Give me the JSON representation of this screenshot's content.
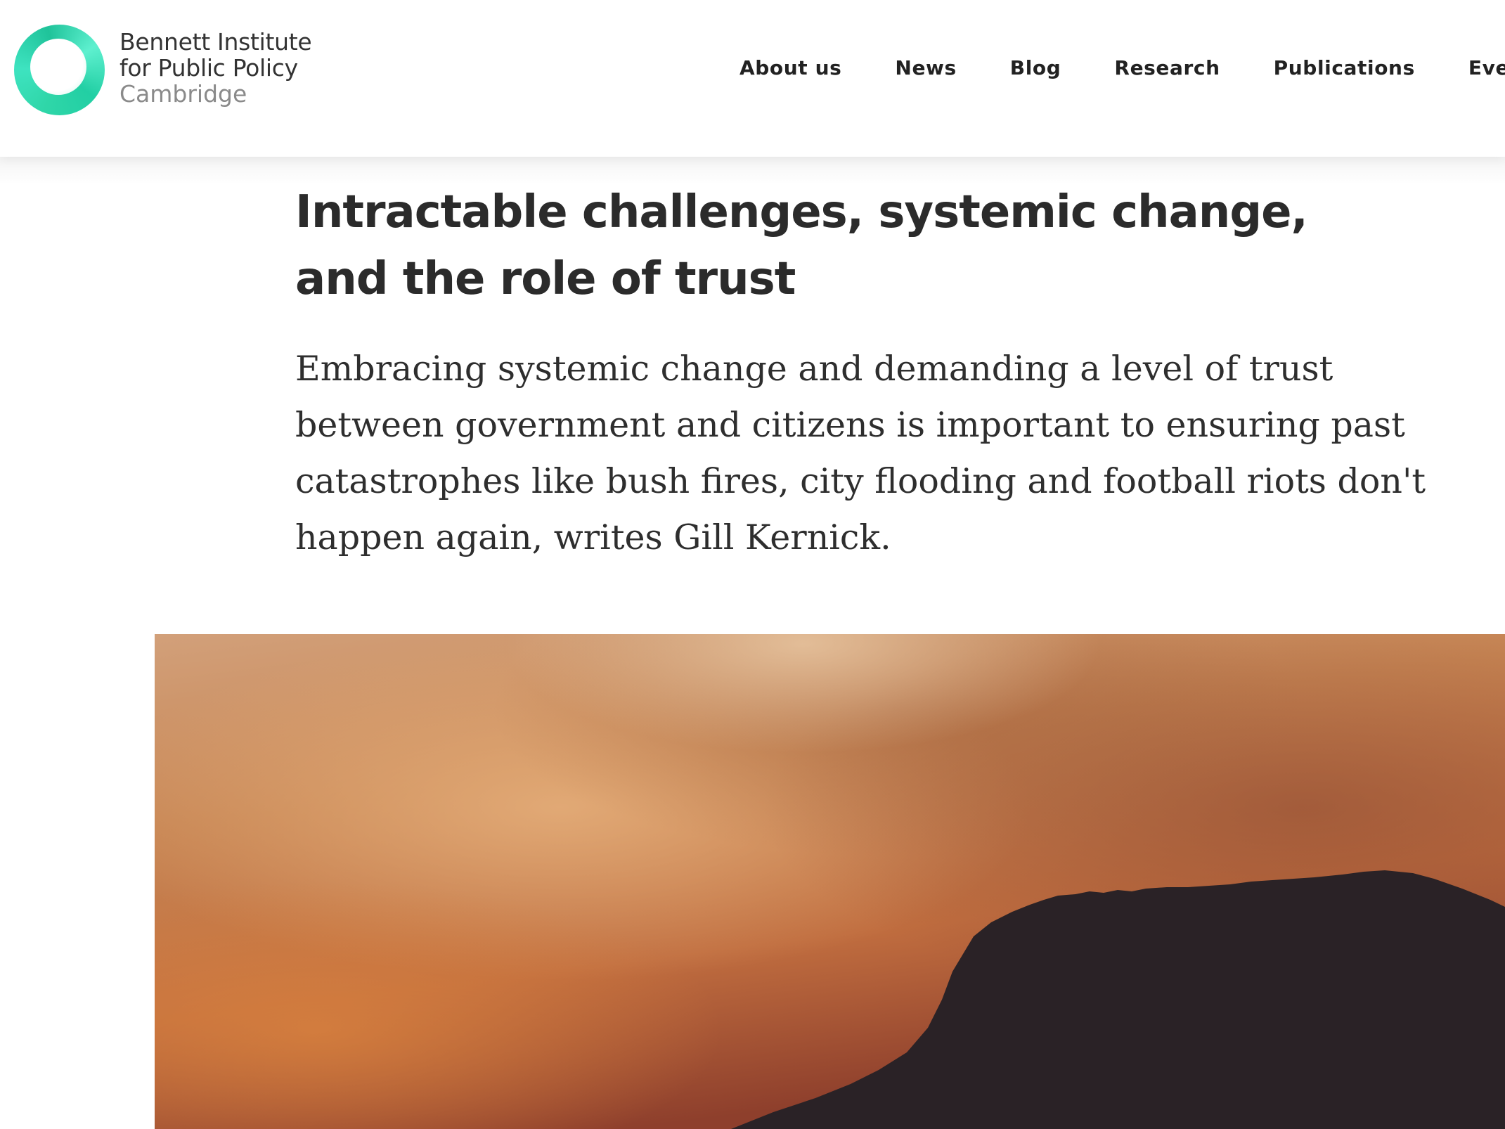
{
  "brand": {
    "line1": "Bennett Institute",
    "line2": "for Public Policy",
    "line3": "Cambridge",
    "accent_color": "#2fd6a8"
  },
  "nav": {
    "items": [
      {
        "label": "About us"
      },
      {
        "label": "News"
      },
      {
        "label": "Blog"
      },
      {
        "label": "Research"
      },
      {
        "label": "Publications"
      },
      {
        "label": "Events"
      }
    ]
  },
  "article": {
    "title": "Intractable challenges, systemic change, and the role of trust",
    "standfirst": "Embracing systemic change and demanding a level of trust between government and citizens is important to ensuring past catastrophes like bush fires, city flooding and football riots don't happen again, writes Gill Kernick."
  },
  "hero_image": {
    "subject": "smoky orange sky over dark mountain silhouette",
    "colors": [
      "#d9a57a",
      "#c67c4d",
      "#9c4e30",
      "#2b2125"
    ]
  }
}
